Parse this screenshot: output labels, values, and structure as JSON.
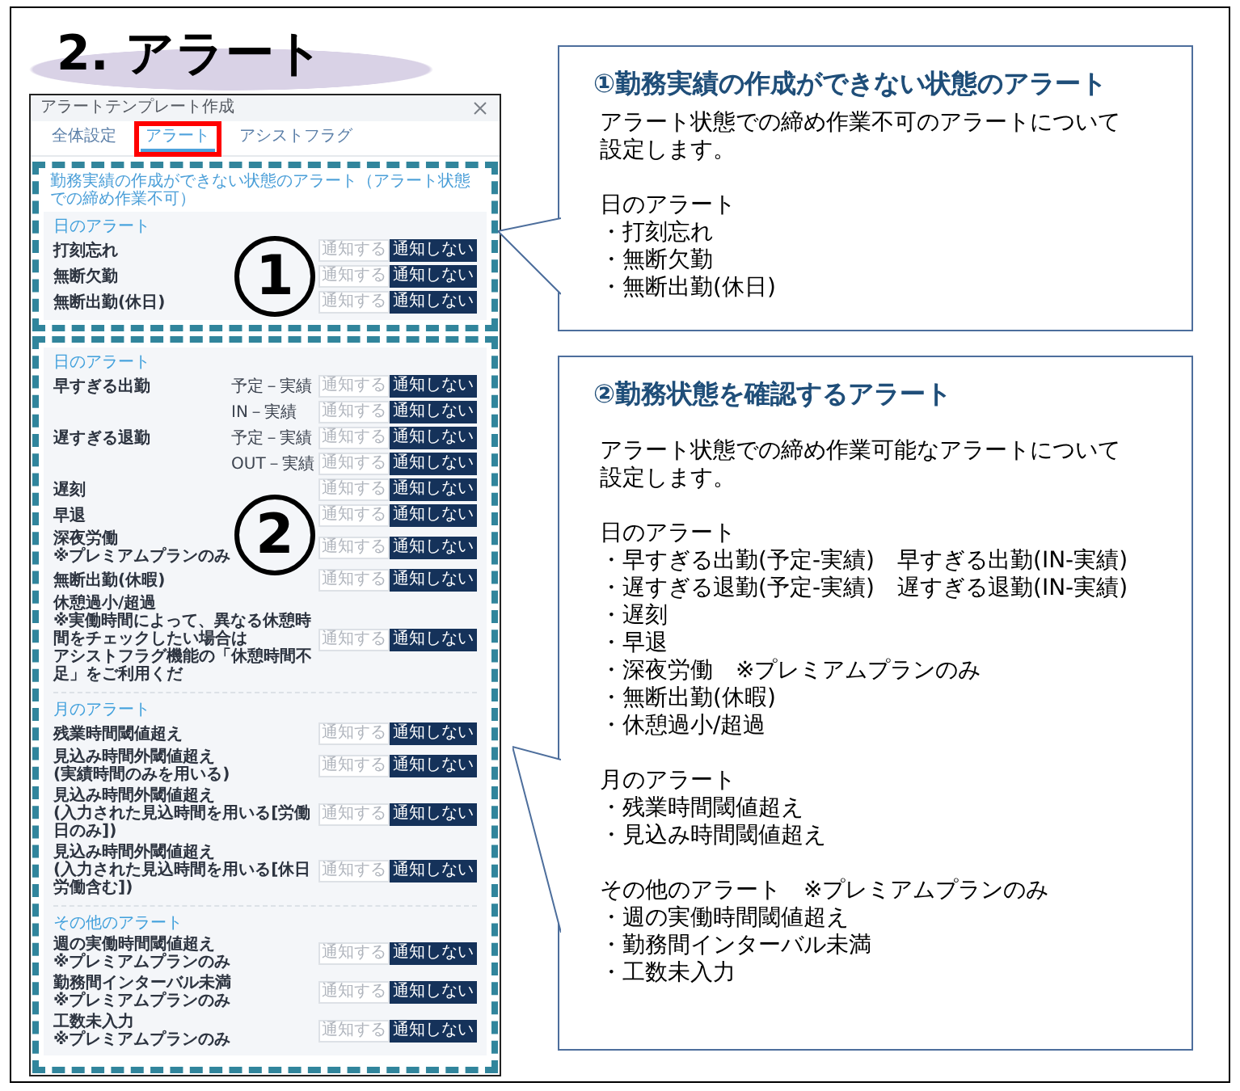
{
  "title": "2. アラート",
  "dialog": {
    "title": "アラートテンプレート作成",
    "tabs": [
      {
        "label": "全体設定",
        "selected": false,
        "highlighted": false
      },
      {
        "label": "アラート",
        "selected": true,
        "highlighted": true
      },
      {
        "label": "アシストフラグ",
        "selected": false,
        "highlighted": false
      }
    ],
    "sections": [
      {
        "marker": "1",
        "heading": "勤務実績の作成ができない状態のアラート（アラート状態での締め作業不可）",
        "groups": [
          {
            "title": "日のアラート",
            "rows": [
              {
                "lines": [
                  "打刻忘れ"
                ],
                "options": [
                  {
                    "label": "通知する",
                    "selected": false
                  },
                  {
                    "label": "通知しない",
                    "selected": true
                  }
                ]
              },
              {
                "lines": [
                  "無断欠勤"
                ],
                "options": [
                  {
                    "label": "通知する",
                    "selected": false
                  },
                  {
                    "label": "通知しない",
                    "selected": true
                  }
                ]
              },
              {
                "lines": [
                  "無断出勤(休日)"
                ],
                "options": [
                  {
                    "label": "通知する",
                    "selected": false
                  },
                  {
                    "label": "通知しない",
                    "selected": true
                  }
                ]
              }
            ]
          }
        ]
      },
      {
        "marker": "2",
        "groups": [
          {
            "title": "日のアラート",
            "rows": [
              {
                "lines": [
                  "早すぎる出勤"
                ],
                "sub": "予定－実績",
                "options": [
                  {
                    "label": "通知する",
                    "selected": false
                  },
                  {
                    "label": "通知しない",
                    "selected": true
                  }
                ]
              },
              {
                "sub": "IN－実績",
                "options": [
                  {
                    "label": "通知する",
                    "selected": false
                  },
                  {
                    "label": "通知しない",
                    "selected": true
                  }
                ]
              },
              {
                "lines": [
                  "遅すぎる退勤"
                ],
                "sub": "予定－実績",
                "options": [
                  {
                    "label": "通知する",
                    "selected": false
                  },
                  {
                    "label": "通知しない",
                    "selected": true
                  }
                ]
              },
              {
                "sub": "OUT－実績",
                "options": [
                  {
                    "label": "通知する",
                    "selected": false
                  },
                  {
                    "label": "通知しない",
                    "selected": true
                  }
                ]
              },
              {
                "lines": [
                  "遅刻"
                ],
                "options": [
                  {
                    "label": "通知する",
                    "selected": false
                  },
                  {
                    "label": "通知しない",
                    "selected": true
                  }
                ]
              },
              {
                "lines": [
                  "早退"
                ],
                "options": [
                  {
                    "label": "通知する",
                    "selected": false
                  },
                  {
                    "label": "通知しない",
                    "selected": true
                  }
                ]
              },
              {
                "lines": [
                  "深夜労働",
                  "※プレミアムプランのみ"
                ],
                "options": [
                  {
                    "label": "通知する",
                    "selected": false
                  },
                  {
                    "label": "通知しない",
                    "selected": true
                  }
                ]
              },
              {
                "lines": [
                  "無断出勤(休暇)"
                ],
                "options": [
                  {
                    "label": "通知する",
                    "selected": false
                  },
                  {
                    "label": "通知しない",
                    "selected": true
                  }
                ]
              },
              {
                "lines": [
                  "休憩過小/超過",
                  "※実働時間によって、異なる休憩時間をチェックしたい場合は",
                  "アシストフラグ機能の「休憩時間不足」をご利用くだ"
                ],
                "options": [
                  {
                    "label": "通知する",
                    "selected": false
                  },
                  {
                    "label": "通知しない",
                    "selected": true
                  }
                ]
              }
            ]
          },
          {
            "title": "月のアラート",
            "rows": [
              {
                "lines": [
                  "残業時間閾値超え"
                ],
                "options": [
                  {
                    "label": "通知する",
                    "selected": false
                  },
                  {
                    "label": "通知しない",
                    "selected": true
                  }
                ]
              },
              {
                "lines": [
                  "見込み時間外閾値超え",
                  "(実績時間のみを用いる)"
                ],
                "options": [
                  {
                    "label": "通知する",
                    "selected": false
                  },
                  {
                    "label": "通知しない",
                    "selected": true
                  }
                ]
              },
              {
                "lines": [
                  "見込み時間外閾値超え",
                  "(入力された見込時間を用いる[労働日のみ])"
                ],
                "options": [
                  {
                    "label": "通知する",
                    "selected": false
                  },
                  {
                    "label": "通知しない",
                    "selected": true
                  }
                ]
              },
              {
                "lines": [
                  "見込み時間外閾値超え",
                  "(入力された見込時間を用いる[休日労働含む])"
                ],
                "options": [
                  {
                    "label": "通知する",
                    "selected": false
                  },
                  {
                    "label": "通知しない",
                    "selected": true
                  }
                ]
              }
            ]
          },
          {
            "title": "その他のアラート",
            "rows": [
              {
                "lines": [
                  "週の実働時間閾値超え",
                  "※プレミアムプランのみ"
                ],
                "options": [
                  {
                    "label": "通知する",
                    "selected": false
                  },
                  {
                    "label": "通知しない",
                    "selected": true
                  }
                ]
              },
              {
                "lines": [
                  "勤務間インターバル未満",
                  "※プレミアムプランのみ"
                ],
                "options": [
                  {
                    "label": "通知する",
                    "selected": false
                  },
                  {
                    "label": "通知しない",
                    "selected": true
                  }
                ]
              },
              {
                "lines": [
                  "工数未入力",
                  "※プレミアムプランのみ"
                ],
                "options": [
                  {
                    "label": "通知する",
                    "selected": false
                  },
                  {
                    "label": "通知しない",
                    "selected": true
                  }
                ]
              }
            ]
          }
        ]
      }
    ]
  },
  "callouts": [
    {
      "title": "①勤務実績の作成ができない状態のアラート",
      "text": "アラート状態での締め作業不可のアラートについて設定します。",
      "groups": [
        {
          "title": "日のアラート",
          "items": [
            "・打刻忘れ",
            "・無断欠勤",
            "・無断出勤(休日)"
          ]
        }
      ]
    },
    {
      "title": "②勤務状態を確認するアラート",
      "text": "アラート状態での締め作業可能なアラートについて設定します。",
      "groups": [
        {
          "title": "日のアラート",
          "items": [
            "・早すぎる出勤(予定-実績)　早すぎる出勤(IN-実績)",
            "・遅すぎる退勤(予定-実績)　遅すぎる退勤(IN-実績)",
            "・遅刻",
            "・早退",
            "・深夜労働　※プレミアムプランのみ",
            "・無断出勤(休暇)",
            "・休憩過小/超過"
          ]
        },
        {
          "title": "月のアラート",
          "items": [
            "・残業時間閾値超え",
            "・見込み時間閾値超え"
          ]
        },
        {
          "title": "その他のアラート　※プレミアムプランのみ",
          "items": [
            "・週の実働時間閾値超え",
            "・勤務間インターバル未満",
            "・工数未入力"
          ]
        }
      ]
    }
  ]
}
